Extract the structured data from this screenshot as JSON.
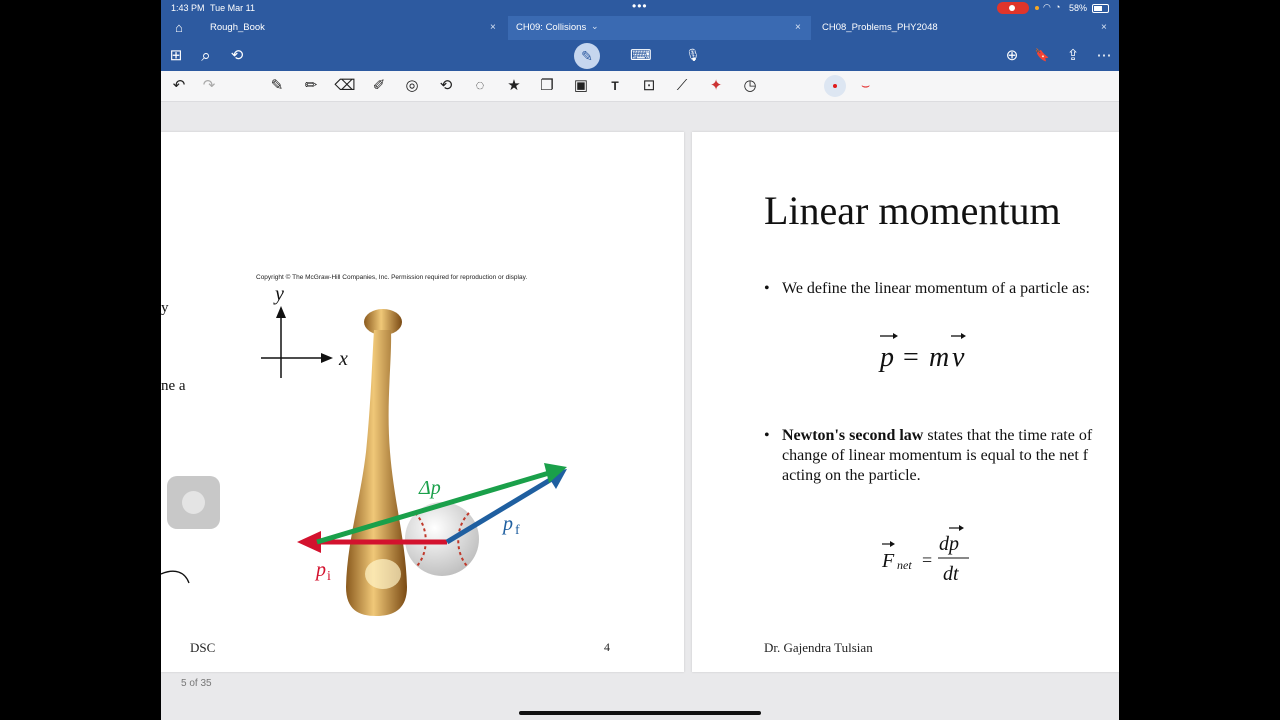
{
  "status_bar": {
    "time": "1:43 PM",
    "date": "Tue Mar 11",
    "battery": "58%"
  },
  "tabs": [
    {
      "label": "Rough_Book",
      "active": false
    },
    {
      "label": "CH09: Collisions",
      "active": true
    },
    {
      "label": "CH08_Problems_PHY2048",
      "active": false
    }
  ],
  "tab_close": "×",
  "active_tab_chevron": "⌄",
  "icons": {
    "home": "⌂",
    "grid": "⊞",
    "search": "⌕",
    "lasso": "⟲",
    "pen": "✎",
    "keyboard": "⌨",
    "mic": "🎙",
    "add_page": "⊕",
    "bookmark": "🔖",
    "share": "⇪",
    "more": "⋯",
    "undo": "↶",
    "redo": "↷"
  },
  "tools": [
    {
      "name": "pen",
      "glyph": "✎"
    },
    {
      "name": "pencil",
      "glyph": "✏"
    },
    {
      "name": "eraser",
      "glyph": "⌫"
    },
    {
      "name": "highlighter",
      "glyph": "✐"
    },
    {
      "name": "shape",
      "glyph": "◎"
    },
    {
      "name": "lasso",
      "glyph": "⟲"
    },
    {
      "name": "select",
      "glyph": "◌"
    },
    {
      "name": "sticker",
      "glyph": "★"
    },
    {
      "name": "element",
      "glyph": "❐"
    },
    {
      "name": "image",
      "glyph": "▣"
    },
    {
      "name": "text",
      "glyph": "T"
    },
    {
      "name": "camera",
      "glyph": "⊡"
    },
    {
      "name": "ruler",
      "glyph": "⟋"
    },
    {
      "name": "laser",
      "glyph": "✦"
    },
    {
      "name": "timer",
      "glyph": "◷"
    }
  ],
  "colors": {
    "accent": "#2d5aa0",
    "active_tab": "#3a6ab2",
    "ink_red": "#e01a1a"
  },
  "left_page": {
    "copyright": "Copyright © The McGraw-Hill Companies, Inc. Permission required for reproduction or display.",
    "fragment_1": "y",
    "fragment_2": "ne a",
    "footer": "DSC",
    "page_number": "4",
    "figure": {
      "axis_x": "x",
      "axis_y": "y",
      "delta_p": "Δp",
      "p_final": "p",
      "p_final_sub": "f",
      "p_initial": "p",
      "p_initial_sub": "i"
    }
  },
  "right_page": {
    "title": "Linear momentum",
    "bullet_1": "We define the linear momentum of a particle as:",
    "equation_1": {
      "lhs": "p",
      "eq": "=",
      "m": "m",
      "v": "v"
    },
    "bullet_2_bold": "Newton's second law",
    "bullet_2_line1": " states that the time rate of",
    "bullet_2_line2": "change of linear momentum is equal to the net f",
    "bullet_2_line3": "acting on the particle.",
    "equation_2": {
      "F": "F",
      "sub": "net",
      "eq": "=",
      "num": "dp",
      "den": "dt"
    },
    "footer": "Dr. Gajendra Tulsian"
  },
  "page_counter": "5 of 35"
}
